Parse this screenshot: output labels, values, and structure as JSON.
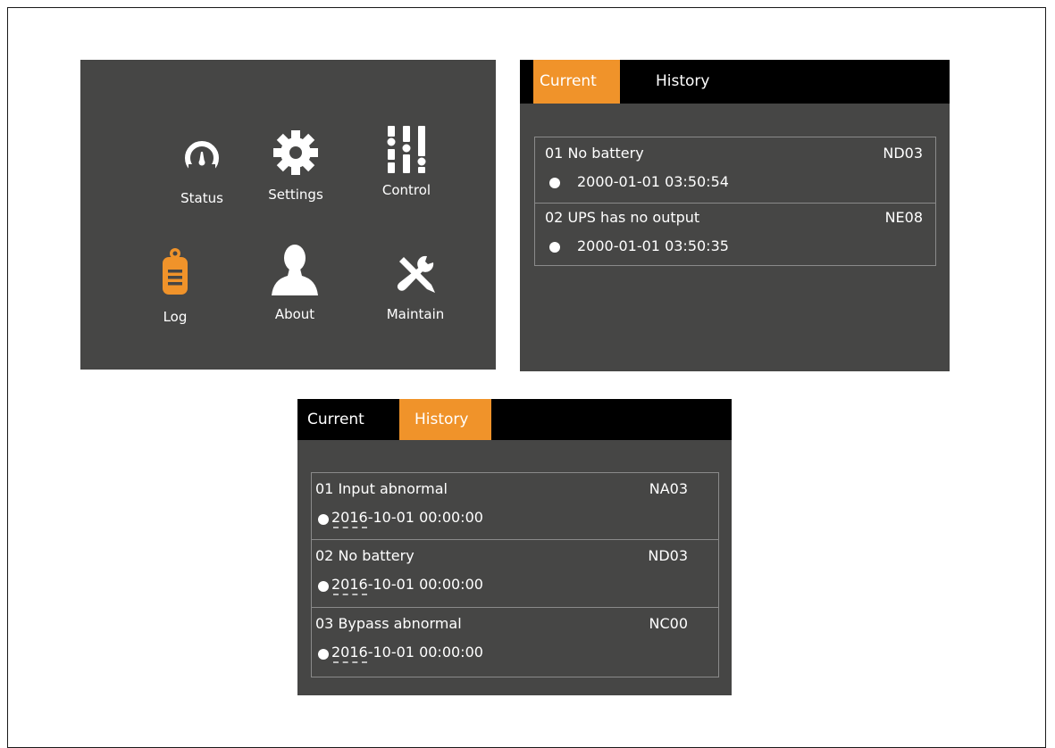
{
  "menu": {
    "items": [
      {
        "label": "Status",
        "icon": "gauge-icon"
      },
      {
        "label": "Settings",
        "icon": "gear-icon"
      },
      {
        "label": "Control",
        "icon": "sliders-icon"
      },
      {
        "label": "Log",
        "icon": "clipboard-icon"
      },
      {
        "label": "About",
        "icon": "user-icon"
      },
      {
        "label": "Maintain",
        "icon": "tools-icon"
      }
    ]
  },
  "current_screen": {
    "tabs": [
      {
        "label": "Current",
        "active": true
      },
      {
        "label": "History",
        "active": false
      }
    ],
    "alarms": [
      {
        "title": "01  No battery",
        "code": "ND03",
        "time": "2000-01-01 03:50:54"
      },
      {
        "title": "02  UPS has no output",
        "code": "NE08",
        "time": "2000-01-01 03:50:35"
      }
    ]
  },
  "history_screen": {
    "tabs": [
      {
        "label": "Current",
        "active": false
      },
      {
        "label": "History",
        "active": true
      }
    ],
    "alarms": [
      {
        "title": "01 Input abnormal",
        "code": "NA03",
        "time": "2016-10-01 00:00:00"
      },
      {
        "title": "02 No battery",
        "code": "ND03",
        "time": "2016-10-01 00:00:00"
      },
      {
        "title": "03 Bypass abnormal",
        "code": "NC00",
        "time": "2016-10-01 00:00:00"
      }
    ]
  },
  "colors": {
    "panel_bg": "#464645",
    "tab_bar_bg": "#000000",
    "accent_orange": "#f0932a",
    "text": "#ffffff",
    "divider": "#8a8a8a"
  }
}
